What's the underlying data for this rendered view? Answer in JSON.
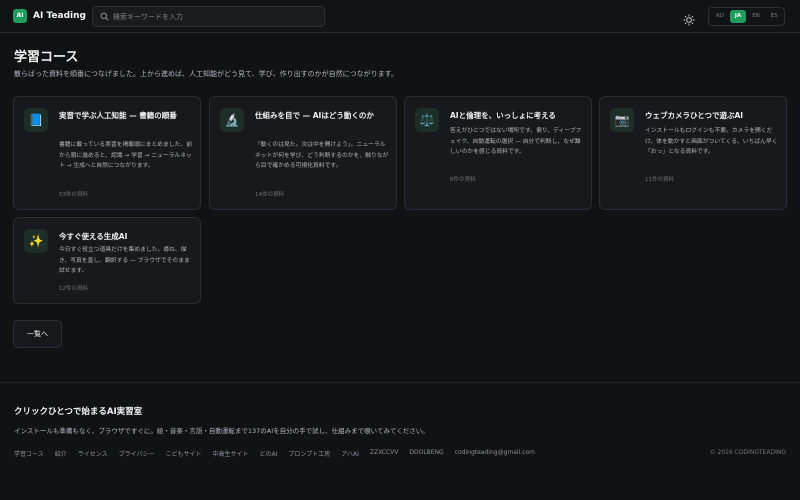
{
  "header": {
    "logo_mark": "AI",
    "logo_text": "AI Teading",
    "search_placeholder": "検索キーワードを入力",
    "theme_icon": "sun-icon",
    "languages": [
      {
        "code": "KO",
        "active": false
      },
      {
        "code": "JA",
        "active": true
      },
      {
        "code": "EN",
        "active": false
      },
      {
        "code": "ES",
        "active": false
      }
    ]
  },
  "main": {
    "title": "学習コース",
    "description": "散らばった資料を順番につなげました。上から進めば、人工知能がどう見て、学び、作り出すのかが自然につながります。",
    "cards": [
      {
        "icon": "book-icon",
        "emoji": "📘",
        "title": "実習で学ぶ人工知能 — 書籍の順番",
        "description": "書籍に載っている実習を掲載順にまとめました。前から順に進めると、認識 → 学習 → ニューラルネット → 生成へと自然につながります。",
        "count": "53件の資料"
      },
      {
        "icon": "microscope-icon",
        "emoji": "🔬",
        "title": "仕組みを目で — AIはどう動くのか",
        "description": "「動くのは見た。次は中を開けよう」。ニューラルネットが何を学び、どう判断するのかを、触りながら目で確かめる可視化資料です。",
        "count": "14件の資料"
      },
      {
        "icon": "scales-icon",
        "emoji": "⚖️",
        "title": "AIと倫理を、いっしょに考える",
        "description": "答えがひとつではない場所です。偏り、ディープフェイク、自動運転の選択 — 自分で判断し、なぜ難しいのかを感じる資料です。",
        "count": "8件の資料"
      },
      {
        "icon": "camera-icon",
        "emoji": "📷",
        "title": "ウェブカメラひとつで遊ぶAI",
        "description": "インストールもログインも不要。カメラを開くだけ。体を動かすと画面がついてくる、いちばん早く「おっ」となる資料です。",
        "count": "11件の資料"
      },
      {
        "icon": "sparkles-icon",
        "emoji": "✨",
        "title": "今すぐ使える生成AI",
        "description": "今日すぐ役立つ道具だけを集めました。尋ね、描き、写真を直し、翻訳する — ブラウザでそのまま試せます。",
        "count": "12件の資料"
      }
    ],
    "back_label": "一覧へ"
  },
  "footer": {
    "title": "クリックひとつで始まるAI実習室",
    "description": "インストールも準備もなく、ブラウザですぐに。絵・音楽・言語・自動運転まで137のAIを自分の手で試し、仕組みまで覗いてみてください。",
    "links": [
      "学習コース",
      "紹介",
      "ライセンス",
      "プライバシー",
      "こどもサイト",
      "中高生サイト",
      "どのAI",
      "プロンプト工房",
      "アハAI",
      "ZZXCCVV",
      "DDOLBENG",
      "codingteading@gmail.com"
    ],
    "copyright": "© 2026 CODINGTEADING"
  }
}
